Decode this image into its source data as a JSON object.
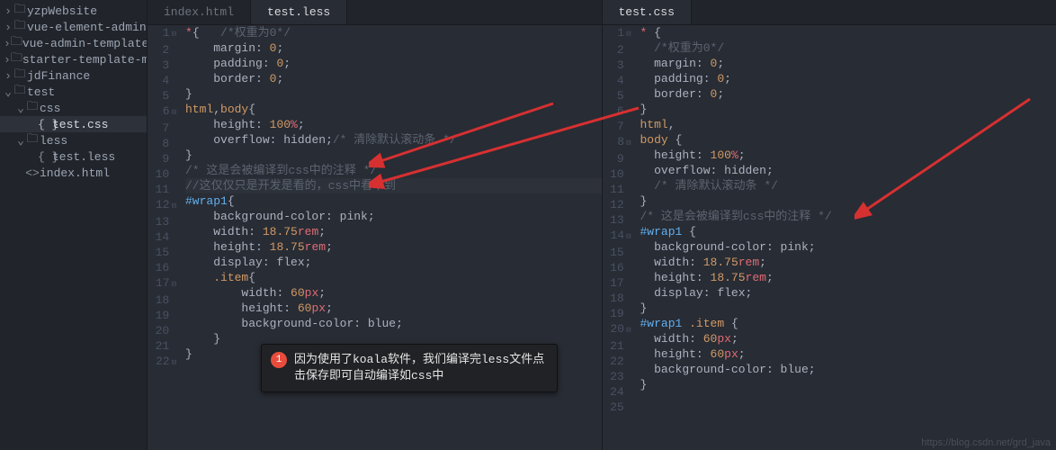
{
  "sidebar": {
    "items": [
      {
        "indent": 0,
        "twist": "›",
        "icon": "🗀",
        "label": "yzpWebsite"
      },
      {
        "indent": 0,
        "twist": "›",
        "icon": "🗀",
        "label": "vue-element-admin"
      },
      {
        "indent": 0,
        "twist": "›",
        "icon": "🗀",
        "label": "vue-admin-template"
      },
      {
        "indent": 0,
        "twist": "›",
        "icon": "🗀",
        "label": "starter-template-master"
      },
      {
        "indent": 0,
        "twist": "›",
        "icon": "🗀",
        "label": "jdFinance"
      },
      {
        "indent": 0,
        "twist": "⌄",
        "icon": "🗀",
        "label": "test"
      },
      {
        "indent": 1,
        "twist": "⌄",
        "icon": "🗀",
        "label": "css"
      },
      {
        "indent": 2,
        "twist": "",
        "icon": "{ }",
        "label": "test.css",
        "selected": true
      },
      {
        "indent": 1,
        "twist": "⌄",
        "icon": "🗀",
        "label": "less"
      },
      {
        "indent": 2,
        "twist": "",
        "icon": "{ }",
        "label": "test.less"
      },
      {
        "indent": 1,
        "twist": "",
        "icon": "<>",
        "label": "index.html"
      }
    ]
  },
  "left": {
    "tabs": [
      {
        "label": "index.html",
        "active": false
      },
      {
        "label": "test.less",
        "active": true
      }
    ],
    "lines": [
      {
        "n": 1,
        "fold": "⊟",
        "seg": [
          [
            "tok-star",
            "*"
          ],
          [
            "tok-punct",
            "{   "
          ],
          [
            "tok-com",
            "/*权重为0*/"
          ]
        ]
      },
      {
        "n": 2,
        "seg": [
          [
            "",
            "    "
          ],
          [
            "tok-prop",
            "margin"
          ],
          [
            "tok-punct",
            ": "
          ],
          [
            "tok-num",
            "0"
          ],
          [
            "tok-punct",
            ";"
          ]
        ]
      },
      {
        "n": 3,
        "seg": [
          [
            "",
            "    "
          ],
          [
            "tok-prop",
            "padding"
          ],
          [
            "tok-punct",
            ": "
          ],
          [
            "tok-num",
            "0"
          ],
          [
            "tok-punct",
            ";"
          ]
        ]
      },
      {
        "n": 4,
        "seg": [
          [
            "",
            "    "
          ],
          [
            "tok-prop",
            "border"
          ],
          [
            "tok-punct",
            ": "
          ],
          [
            "tok-num",
            "0"
          ],
          [
            "tok-punct",
            ";"
          ]
        ]
      },
      {
        "n": 5,
        "seg": [
          [
            "tok-punct",
            "}"
          ]
        ]
      },
      {
        "n": 6,
        "fold": "⊟",
        "seg": [
          [
            "tok-sel",
            "html"
          ],
          [
            "tok-punct",
            ","
          ],
          [
            "tok-sel",
            "body"
          ],
          [
            "tok-punct",
            "{"
          ]
        ]
      },
      {
        "n": 7,
        "seg": [
          [
            "",
            "    "
          ],
          [
            "tok-prop",
            "height"
          ],
          [
            "tok-punct",
            ": "
          ],
          [
            "tok-num",
            "100"
          ],
          [
            "tok-unit",
            "%"
          ],
          [
            "tok-punct",
            ";"
          ]
        ]
      },
      {
        "n": 8,
        "seg": [
          [
            "",
            "    "
          ],
          [
            "tok-prop",
            "overflow"
          ],
          [
            "tok-punct",
            ": "
          ],
          [
            "tok-prop",
            "hidden"
          ],
          [
            "tok-punct",
            ";"
          ],
          [
            "tok-com",
            "/* 清除默认滚动条 */"
          ]
        ]
      },
      {
        "n": 9,
        "seg": [
          [
            "tok-punct",
            "}"
          ]
        ]
      },
      {
        "n": 10,
        "seg": [
          [
            "tok-com",
            "/* 这是会被编译到css中的注释 */"
          ]
        ]
      },
      {
        "n": 11,
        "hl": true,
        "seg": [
          [
            "tok-com",
            "//这仅仅只是开发是看的，css中看不到"
          ]
        ]
      },
      {
        "n": 12,
        "fold": "⊟",
        "seg": [
          [
            "tok-id",
            "#wrap1"
          ],
          [
            "tok-punct",
            "{"
          ]
        ]
      },
      {
        "n": 13,
        "seg": [
          [
            "",
            "    "
          ],
          [
            "tok-prop",
            "background-color"
          ],
          [
            "tok-punct",
            ": "
          ],
          [
            "tok-prop",
            "pink"
          ],
          [
            "tok-punct",
            ";"
          ]
        ]
      },
      {
        "n": 14,
        "seg": [
          [
            "",
            "    "
          ],
          [
            "tok-prop",
            "width"
          ],
          [
            "tok-punct",
            ": "
          ],
          [
            "tok-num",
            "18.75"
          ],
          [
            "tok-unit",
            "rem"
          ],
          [
            "tok-punct",
            ";"
          ]
        ]
      },
      {
        "n": 15,
        "seg": [
          [
            "",
            "    "
          ],
          [
            "tok-prop",
            "height"
          ],
          [
            "tok-punct",
            ": "
          ],
          [
            "tok-num",
            "18.75"
          ],
          [
            "tok-unit",
            "rem"
          ],
          [
            "tok-punct",
            ";"
          ]
        ]
      },
      {
        "n": 16,
        "seg": [
          [
            "",
            "    "
          ],
          [
            "tok-prop",
            "display"
          ],
          [
            "tok-punct",
            ": "
          ],
          [
            "tok-prop",
            "flex"
          ],
          [
            "tok-punct",
            ";"
          ]
        ]
      },
      {
        "n": 17,
        "fold": "⊟",
        "seg": [
          [
            "",
            "    "
          ],
          [
            "tok-sel",
            ".item"
          ],
          [
            "tok-punct",
            "{"
          ]
        ]
      },
      {
        "n": 18,
        "seg": [
          [
            "",
            "        "
          ],
          [
            "tok-prop",
            "width"
          ],
          [
            "tok-punct",
            ": "
          ],
          [
            "tok-num",
            "60"
          ],
          [
            "tok-unit",
            "px"
          ],
          [
            "tok-punct",
            ";"
          ]
        ]
      },
      {
        "n": 19,
        "seg": [
          [
            "",
            "        "
          ],
          [
            "tok-prop",
            "height"
          ],
          [
            "tok-punct",
            ": "
          ],
          [
            "tok-num",
            "60"
          ],
          [
            "tok-unit",
            "px"
          ],
          [
            "tok-punct",
            ";"
          ]
        ]
      },
      {
        "n": 20,
        "seg": [
          [
            "",
            "        "
          ],
          [
            "tok-prop",
            "background-color"
          ],
          [
            "tok-punct",
            ": "
          ],
          [
            "tok-prop",
            "blue"
          ],
          [
            "tok-punct",
            ";"
          ]
        ]
      },
      {
        "n": 21,
        "seg": [
          [
            "",
            "    "
          ],
          [
            "tok-punct",
            "}"
          ]
        ]
      },
      {
        "n": 22,
        "fold": "⊟",
        "seg": [
          [
            "tok-punct",
            "}"
          ]
        ]
      }
    ]
  },
  "right": {
    "tabs": [
      {
        "label": "test.css",
        "active": true
      }
    ],
    "lines": [
      {
        "n": 1,
        "fold": "⊟",
        "seg": [
          [
            "tok-star",
            "*"
          ],
          [
            "tok-punct",
            " {"
          ]
        ]
      },
      {
        "n": 2,
        "seg": [
          [
            "",
            "  "
          ],
          [
            "tok-com",
            "/*权重为0*/"
          ]
        ]
      },
      {
        "n": 3,
        "seg": [
          [
            "",
            "  "
          ],
          [
            "tok-prop",
            "margin"
          ],
          [
            "tok-punct",
            ": "
          ],
          [
            "tok-num",
            "0"
          ],
          [
            "tok-punct",
            ";"
          ]
        ]
      },
      {
        "n": 4,
        "seg": [
          [
            "",
            "  "
          ],
          [
            "tok-prop",
            "padding"
          ],
          [
            "tok-punct",
            ": "
          ],
          [
            "tok-num",
            "0"
          ],
          [
            "tok-punct",
            ";"
          ]
        ]
      },
      {
        "n": 5,
        "seg": [
          [
            "",
            "  "
          ],
          [
            "tok-prop",
            "border"
          ],
          [
            "tok-punct",
            ": "
          ],
          [
            "tok-num",
            "0"
          ],
          [
            "tok-punct",
            ";"
          ]
        ]
      },
      {
        "n": 6,
        "seg": [
          [
            "tok-punct",
            "}"
          ]
        ]
      },
      {
        "n": 7,
        "seg": [
          [
            "tok-sel",
            "html"
          ],
          [
            "tok-punct",
            ","
          ]
        ]
      },
      {
        "n": 8,
        "fold": "⊟",
        "seg": [
          [
            "tok-sel",
            "body"
          ],
          [
            "tok-punct",
            " {"
          ]
        ]
      },
      {
        "n": 9,
        "seg": [
          [
            "",
            "  "
          ],
          [
            "tok-prop",
            "height"
          ],
          [
            "tok-punct",
            ": "
          ],
          [
            "tok-num",
            "100"
          ],
          [
            "tok-unit",
            "%"
          ],
          [
            "tok-punct",
            ";"
          ]
        ]
      },
      {
        "n": 10,
        "seg": [
          [
            "",
            "  "
          ],
          [
            "tok-prop",
            "overflow"
          ],
          [
            "tok-punct",
            ": "
          ],
          [
            "tok-prop",
            "hidden"
          ],
          [
            "tok-punct",
            ";"
          ]
        ]
      },
      {
        "n": 11,
        "seg": [
          [
            "",
            "  "
          ],
          [
            "tok-com",
            "/* 清除默认滚动条 */"
          ]
        ]
      },
      {
        "n": 12,
        "seg": [
          [
            "tok-punct",
            "}"
          ]
        ]
      },
      {
        "n": 13,
        "seg": [
          [
            "tok-com",
            "/* 这是会被编译到css中的注释 */"
          ]
        ]
      },
      {
        "n": 14,
        "fold": "⊟",
        "seg": [
          [
            "tok-id",
            "#wrap1"
          ],
          [
            "tok-punct",
            " {"
          ]
        ]
      },
      {
        "n": 15,
        "seg": [
          [
            "",
            "  "
          ],
          [
            "tok-prop",
            "background-color"
          ],
          [
            "tok-punct",
            ": "
          ],
          [
            "tok-prop",
            "pink"
          ],
          [
            "tok-punct",
            ";"
          ]
        ]
      },
      {
        "n": 16,
        "seg": [
          [
            "",
            "  "
          ],
          [
            "tok-prop",
            "width"
          ],
          [
            "tok-punct",
            ": "
          ],
          [
            "tok-num",
            "18.75"
          ],
          [
            "tok-unit",
            "rem"
          ],
          [
            "tok-punct",
            ";"
          ]
        ]
      },
      {
        "n": 17,
        "seg": [
          [
            "",
            "  "
          ],
          [
            "tok-prop",
            "height"
          ],
          [
            "tok-punct",
            ": "
          ],
          [
            "tok-num",
            "18.75"
          ],
          [
            "tok-unit",
            "rem"
          ],
          [
            "tok-punct",
            ";"
          ]
        ]
      },
      {
        "n": 18,
        "seg": [
          [
            "",
            "  "
          ],
          [
            "tok-prop",
            "display"
          ],
          [
            "tok-punct",
            ": "
          ],
          [
            "tok-prop",
            "flex"
          ],
          [
            "tok-punct",
            ";"
          ]
        ]
      },
      {
        "n": 19,
        "seg": [
          [
            "tok-punct",
            "}"
          ]
        ]
      },
      {
        "n": 20,
        "fold": "⊟",
        "seg": [
          [
            "tok-id",
            "#wrap1"
          ],
          [
            "tok-punct",
            " "
          ],
          [
            "tok-sel",
            ".item"
          ],
          [
            "tok-punct",
            " {"
          ]
        ]
      },
      {
        "n": 21,
        "seg": [
          [
            "",
            "  "
          ],
          [
            "tok-prop",
            "width"
          ],
          [
            "tok-punct",
            ": "
          ],
          [
            "tok-num",
            "60"
          ],
          [
            "tok-unit",
            "px"
          ],
          [
            "tok-punct",
            ";"
          ]
        ]
      },
      {
        "n": 22,
        "seg": [
          [
            "",
            "  "
          ],
          [
            "tok-prop",
            "height"
          ],
          [
            "tok-punct",
            ": "
          ],
          [
            "tok-num",
            "60"
          ],
          [
            "tok-unit",
            "px"
          ],
          [
            "tok-punct",
            ";"
          ]
        ]
      },
      {
        "n": 23,
        "seg": [
          [
            "",
            "  "
          ],
          [
            "tok-prop",
            "background-color"
          ],
          [
            "tok-punct",
            ": "
          ],
          [
            "tok-prop",
            "blue"
          ],
          [
            "tok-punct",
            ";"
          ]
        ]
      },
      {
        "n": 24,
        "seg": [
          [
            "tok-punct",
            "}"
          ]
        ]
      },
      {
        "n": 25,
        "seg": [
          [
            "",
            ""
          ]
        ]
      }
    ]
  },
  "callout": {
    "badge": "1",
    "text": "因为使用了koala软件，我们编译完less文件点击保存即可自动编译如css中"
  },
  "watermark": "https://blog.csdn.net/grd_java"
}
